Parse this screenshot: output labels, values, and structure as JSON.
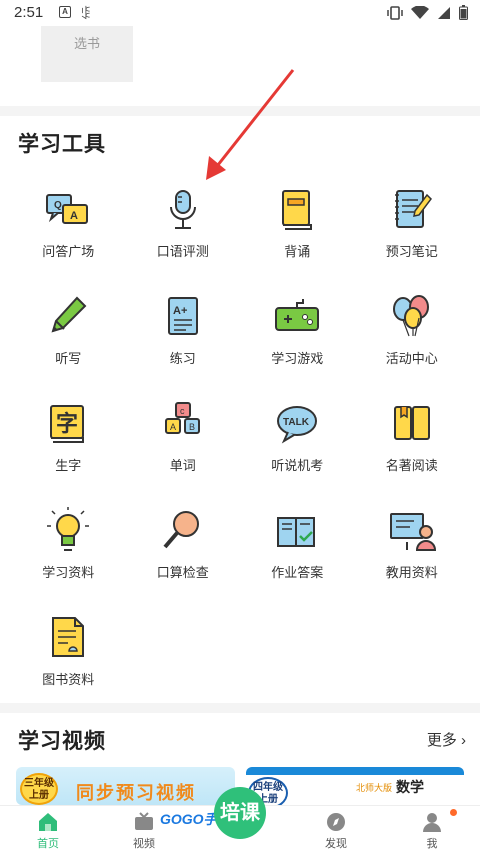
{
  "status_bar": {
    "time": "2:51",
    "icon_a": "A"
  },
  "top_card": {
    "label": "选书"
  },
  "tools_section": {
    "title": "学习工具",
    "tools": [
      {
        "label": "问答广场",
        "icon": "qa-icon"
      },
      {
        "label": "口语评测",
        "icon": "microphone-icon"
      },
      {
        "label": "背诵",
        "icon": "book-icon"
      },
      {
        "label": "预习笔记",
        "icon": "notebook-icon"
      },
      {
        "label": "听写",
        "icon": "pencil-icon"
      },
      {
        "label": "练习",
        "icon": "practice-sheet-icon"
      },
      {
        "label": "学习游戏",
        "icon": "gamepad-icon"
      },
      {
        "label": "活动中心",
        "icon": "balloons-icon"
      },
      {
        "label": "生字",
        "icon": "character-card-icon"
      },
      {
        "label": "单词",
        "icon": "letter-blocks-icon"
      },
      {
        "label": "听说机考",
        "icon": "talk-bubble-icon"
      },
      {
        "label": "名著阅读",
        "icon": "open-book-icon"
      },
      {
        "label": "学习资料",
        "icon": "lightbulb-icon"
      },
      {
        "label": "口算检查",
        "icon": "magnifier-icon"
      },
      {
        "label": "作业答案",
        "icon": "answer-book-icon"
      },
      {
        "label": "教用资料",
        "icon": "teacher-board-icon"
      },
      {
        "label": "图书资料",
        "icon": "document-icon"
      }
    ]
  },
  "videos_section": {
    "title": "学习视频",
    "more": "更多",
    "card1": {
      "badge_line1": "三年级",
      "badge_line2": "上册",
      "title": "同步预习视频"
    },
    "card2": {
      "badge_line1": "四年级",
      "badge_line2": "上册",
      "publisher": "北师大版",
      "subject": "数学"
    }
  },
  "watermark": {
    "text": "GOGO手游网",
    "circle": "培课"
  },
  "bottom_nav": [
    {
      "label": "首页",
      "icon": "home-icon",
      "active": true
    },
    {
      "label": "视频",
      "icon": "tv-icon",
      "active": false
    },
    {
      "label": "",
      "icon": "center-icon",
      "active": false
    },
    {
      "label": "发现",
      "icon": "compass-icon",
      "active": false
    },
    {
      "label": "我",
      "icon": "user-icon",
      "active": false
    }
  ],
  "colors": {
    "accent": "#2fbd7a",
    "arrow": "#e53935",
    "icon_yellow": "#ffd84a",
    "icon_blue": "#9fd4f0"
  }
}
